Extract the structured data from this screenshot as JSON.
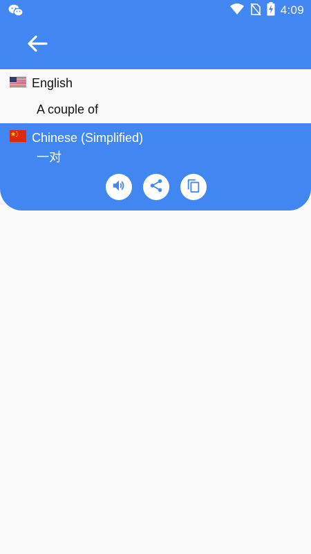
{
  "status_bar": {
    "time": "4:09",
    "icons": [
      "wechat-icon",
      "wifi-icon",
      "no-sim-icon",
      "battery-charging-icon"
    ]
  },
  "toolbar": {
    "back_icon": "arrow-left-icon"
  },
  "source": {
    "language": "English",
    "flag_icon": "us-flag-icon",
    "text": "A couple of"
  },
  "result": {
    "language": "Chinese (Simplified)",
    "flag_icon": "china-flag-icon",
    "text": "一对",
    "actions": [
      "speaker-icon",
      "share-icon",
      "copy-icon"
    ]
  },
  "colors": {
    "primary": "#4286f2",
    "background": "#fafafa",
    "text": "#111111"
  }
}
